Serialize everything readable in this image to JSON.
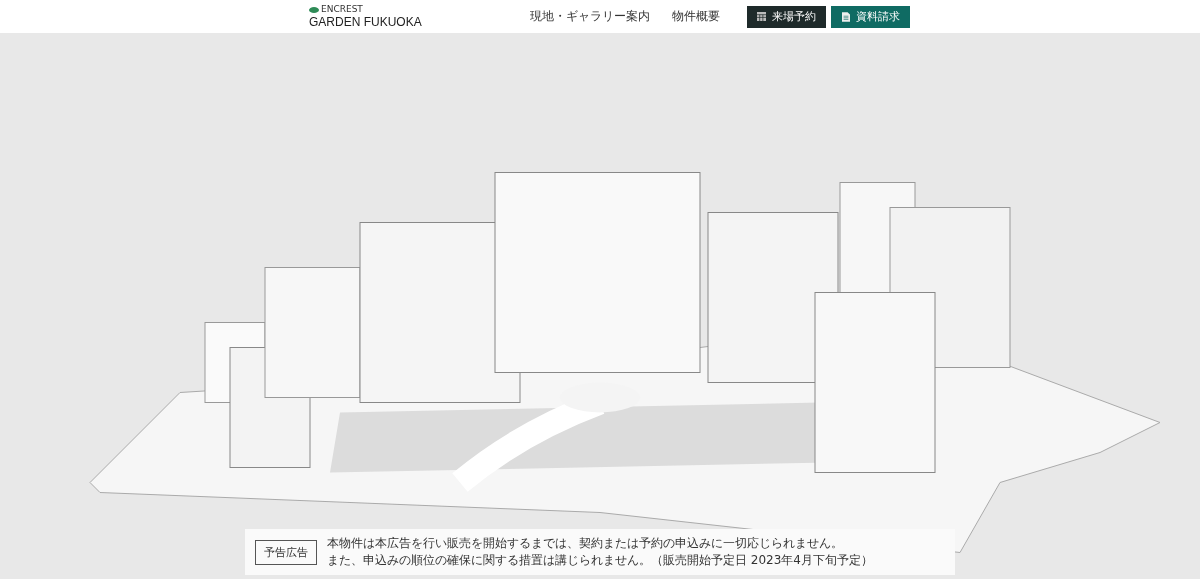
{
  "header": {
    "logo_small": "ENCREST",
    "logo": "GARDEN FUKUOKA",
    "nav": [
      {
        "label": "現地・ギャラリー案内",
        "kind": "link"
      },
      {
        "label": "物件概要",
        "kind": "link"
      },
      {
        "label": "来場予約",
        "kind": "dark"
      },
      {
        "label": "資料請求",
        "kind": "teal"
      }
    ]
  },
  "notice": {
    "badge": "予告広告",
    "lines": [
      "本物件は本広告を行い販売を開始するまでは、契約または予約の申込みに一切応じられません。",
      "また、申込みの順位の確保に関する措置は講じられません。（販売開始予定日 2023年4月下旬予定）"
    ]
  }
}
